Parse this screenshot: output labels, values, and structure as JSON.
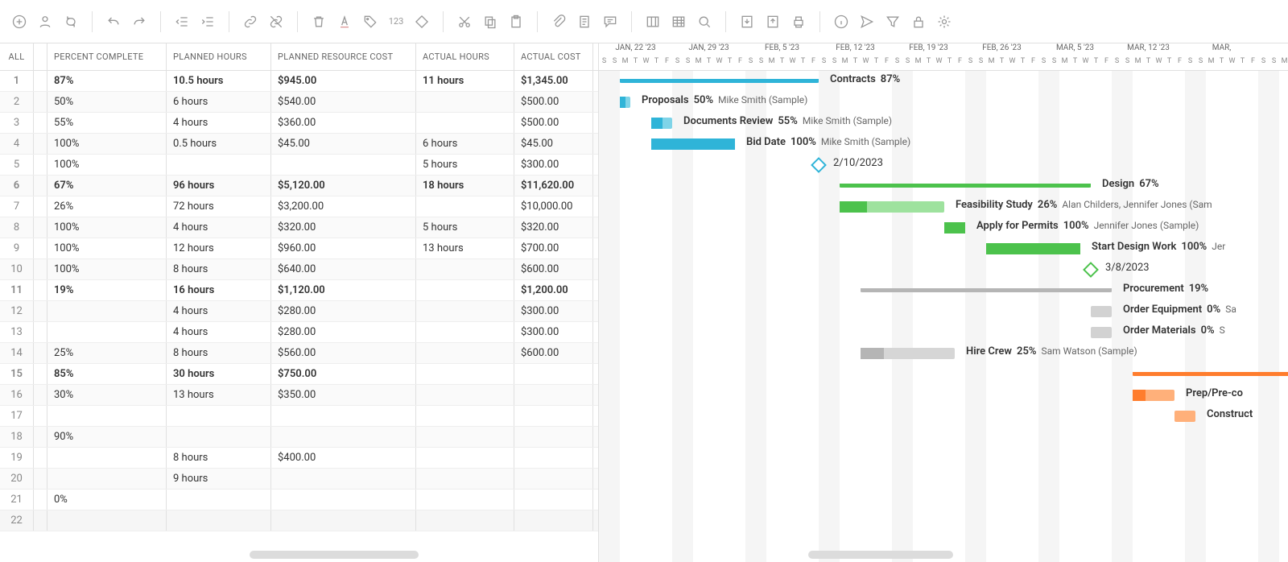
{
  "toolbar": {
    "icons": [
      "add",
      "assign",
      "refresh",
      "undo",
      "redo",
      "outdent",
      "indent",
      "link",
      "unlink",
      "trash",
      "font",
      "tag",
      "123",
      "shape",
      "cut",
      "copy",
      "paste",
      "clip",
      "note",
      "notes",
      "col",
      "grid",
      "zoom",
      "pdf",
      "print",
      "print2",
      "info",
      "send",
      "filter",
      "lock",
      "settings"
    ]
  },
  "columns": {
    "all": "ALL",
    "pct": "PERCENT COMPLETE",
    "plan": "PLANNED HOURS",
    "cost": "PLANNED RESOURCE COST",
    "ahrs": "ACTUAL HOURS",
    "acost": "ACTUAL COST"
  },
  "rows": [
    {
      "n": 1,
      "b": 1,
      "pct": "87%",
      "plan": "10.5 hours",
      "cost": "$945.00",
      "ahrs": "11 hours",
      "acost": "$1,345.00"
    },
    {
      "n": 2,
      "pct": "50%",
      "plan": "6 hours",
      "cost": "$540.00",
      "ahrs": "",
      "acost": "$500.00"
    },
    {
      "n": 3,
      "pct": "55%",
      "plan": "4 hours",
      "cost": "$360.00",
      "ahrs": "",
      "acost": "$500.00"
    },
    {
      "n": 4,
      "pct": "100%",
      "plan": "0.5 hours",
      "cost": "$45.00",
      "ahrs": "6 hours",
      "acost": "$45.00"
    },
    {
      "n": 5,
      "pct": "100%",
      "plan": "",
      "cost": "",
      "ahrs": "5 hours",
      "acost": "$300.00"
    },
    {
      "n": 6,
      "b": 1,
      "pct": "67%",
      "plan": "96 hours",
      "cost": "$5,120.00",
      "ahrs": "18 hours",
      "acost": "$11,620.00"
    },
    {
      "n": 7,
      "pct": "26%",
      "plan": "72 hours",
      "cost": "$3,200.00",
      "ahrs": "",
      "acost": "$10,000.00"
    },
    {
      "n": 8,
      "pct": "100%",
      "plan": "4 hours",
      "cost": "$320.00",
      "ahrs": "5 hours",
      "acost": "$320.00"
    },
    {
      "n": 9,
      "pct": "100%",
      "plan": "12 hours",
      "cost": "$960.00",
      "ahrs": "13 hours",
      "acost": "$700.00"
    },
    {
      "n": 10,
      "pct": "100%",
      "plan": "8 hours",
      "cost": "$640.00",
      "ahrs": "",
      "acost": "$600.00"
    },
    {
      "n": 11,
      "b": 1,
      "pct": "19%",
      "plan": "16 hours",
      "cost": "$1,120.00",
      "ahrs": "",
      "acost": "$1,200.00"
    },
    {
      "n": 12,
      "pct": "",
      "plan": "4 hours",
      "cost": "$280.00",
      "ahrs": "",
      "acost": "$300.00"
    },
    {
      "n": 13,
      "pct": "",
      "plan": "4 hours",
      "cost": "$280.00",
      "ahrs": "",
      "acost": "$300.00"
    },
    {
      "n": 14,
      "pct": "25%",
      "plan": "8 hours",
      "cost": "$560.00",
      "ahrs": "",
      "acost": "$600.00"
    },
    {
      "n": 15,
      "b": 1,
      "pct": "85%",
      "plan": "30 hours",
      "cost": "$750.00",
      "ahrs": "",
      "acost": ""
    },
    {
      "n": 16,
      "pct": "30%",
      "plan": "13 hours",
      "cost": "$350.00",
      "ahrs": "",
      "acost": ""
    },
    {
      "n": 17,
      "pct": "",
      "plan": "",
      "cost": "",
      "ahrs": "",
      "acost": ""
    },
    {
      "n": 18,
      "pct": "90%",
      "plan": "",
      "cost": "",
      "ahrs": "",
      "acost": ""
    },
    {
      "n": 19,
      "pct": "",
      "plan": "8 hours",
      "cost": "$400.00",
      "ahrs": "",
      "acost": ""
    },
    {
      "n": 20,
      "pct": "",
      "plan": "9 hours",
      "cost": "",
      "ahrs": "",
      "acost": ""
    },
    {
      "n": 21,
      "pct": "0%",
      "plan": "",
      "cost": "",
      "ahrs": "",
      "acost": ""
    },
    {
      "n": 22,
      "pct": "",
      "plan": "",
      "cost": "",
      "ahrs": "",
      "acost": "",
      "hl": 1
    }
  ],
  "timeline": {
    "start_col": 0,
    "weeks": [
      "JAN, 22 '23",
      "JAN, 29 '23",
      "FEB, 5 '23",
      "FEB, 12 '23",
      "FEB, 19 '23",
      "FEB, 26 '23",
      "MAR, 5 '23",
      "MAR, 12 '23",
      "MAR,"
    ],
    "dow": "SSMTWTF"
  },
  "tasks": [
    {
      "row": 0,
      "type": "sum",
      "color": "#2fb4d8",
      "start": 2,
      "end": 21,
      "name": "Contracts",
      "pct": "87%"
    },
    {
      "row": 1,
      "type": "bar",
      "color": "#2fb4d8",
      "start": 2,
      "end": 3,
      "prog": 0.5,
      "name": "Proposals",
      "pct": "50%",
      "asg": "Mike Smith (Sample)"
    },
    {
      "row": 2,
      "type": "bar",
      "color": "#2fb4d8",
      "start": 5,
      "end": 7,
      "prog": 0.55,
      "name": "Documents Review",
      "pct": "55%",
      "asg": "Mike Smith (Sample)"
    },
    {
      "row": 3,
      "type": "bar",
      "color": "#2fb4d8",
      "start": 5,
      "end": 13,
      "prog": 1,
      "name": "Bid Date",
      "pct": "100%",
      "asg": "Mike Smith (Sample)"
    },
    {
      "row": 4,
      "type": "ms",
      "color": "#2fb4d8",
      "start": 21,
      "name": "2/10/2023"
    },
    {
      "row": 5,
      "type": "sum",
      "color": "#4cc24c",
      "start": 23,
      "end": 47,
      "name": "Design",
      "pct": "67%"
    },
    {
      "row": 6,
      "type": "bar",
      "color": "#4cc24c",
      "start": 23,
      "end": 33,
      "prog": 0.26,
      "name": "Feasibility Study",
      "pct": "26%",
      "asg": "Alan Childers, Jennifer Jones (Sam"
    },
    {
      "row": 7,
      "type": "bar",
      "color": "#4cc24c",
      "start": 33,
      "end": 35,
      "prog": 1,
      "name": "Apply for Permits",
      "pct": "100%",
      "asg": "Jennifer Jones (Sample)"
    },
    {
      "row": 8,
      "type": "bar",
      "color": "#4cc24c",
      "start": 37,
      "end": 46,
      "prog": 1,
      "name": "Start Design Work",
      "pct": "100%",
      "asg": "Jer"
    },
    {
      "row": 9,
      "type": "ms",
      "color": "#4cc24c",
      "start": 47,
      "name": "3/8/2023"
    },
    {
      "row": 10,
      "type": "sum",
      "color": "#b5b5b5",
      "start": 25,
      "end": 49,
      "name": "Procurement",
      "pct": "19%"
    },
    {
      "row": 11,
      "type": "bar",
      "color": "#d2d2d2",
      "start": 47,
      "end": 49,
      "prog": 0,
      "name": "Order Equipment",
      "pct": "0%",
      "asg": "Sa"
    },
    {
      "row": 12,
      "type": "bar",
      "color": "#d2d2d2",
      "start": 47,
      "end": 49,
      "prog": 0,
      "name": "Order Materials",
      "pct": "0%",
      "asg": "S"
    },
    {
      "row": 13,
      "type": "bar",
      "color": "#b5b5b5",
      "start": 25,
      "end": 34,
      "prog": 0.25,
      "name": "Hire Crew",
      "pct": "25%",
      "asg": "Sam Watson (Sample)"
    },
    {
      "row": 14,
      "type": "sum",
      "color": "#ff7d2d",
      "start": 51,
      "end": 70,
      "name": "",
      "pct": ""
    },
    {
      "row": 15,
      "type": "bar",
      "color": "#ff7d2d",
      "start": 51,
      "end": 55,
      "prog": 0.3,
      "name": "Prep/Pre-co",
      "pct": ""
    },
    {
      "row": 16,
      "type": "bar",
      "color": "#ffb07a",
      "start": 55,
      "end": 57,
      "prog": 0,
      "name": "Construct",
      "pct": ""
    }
  ]
}
